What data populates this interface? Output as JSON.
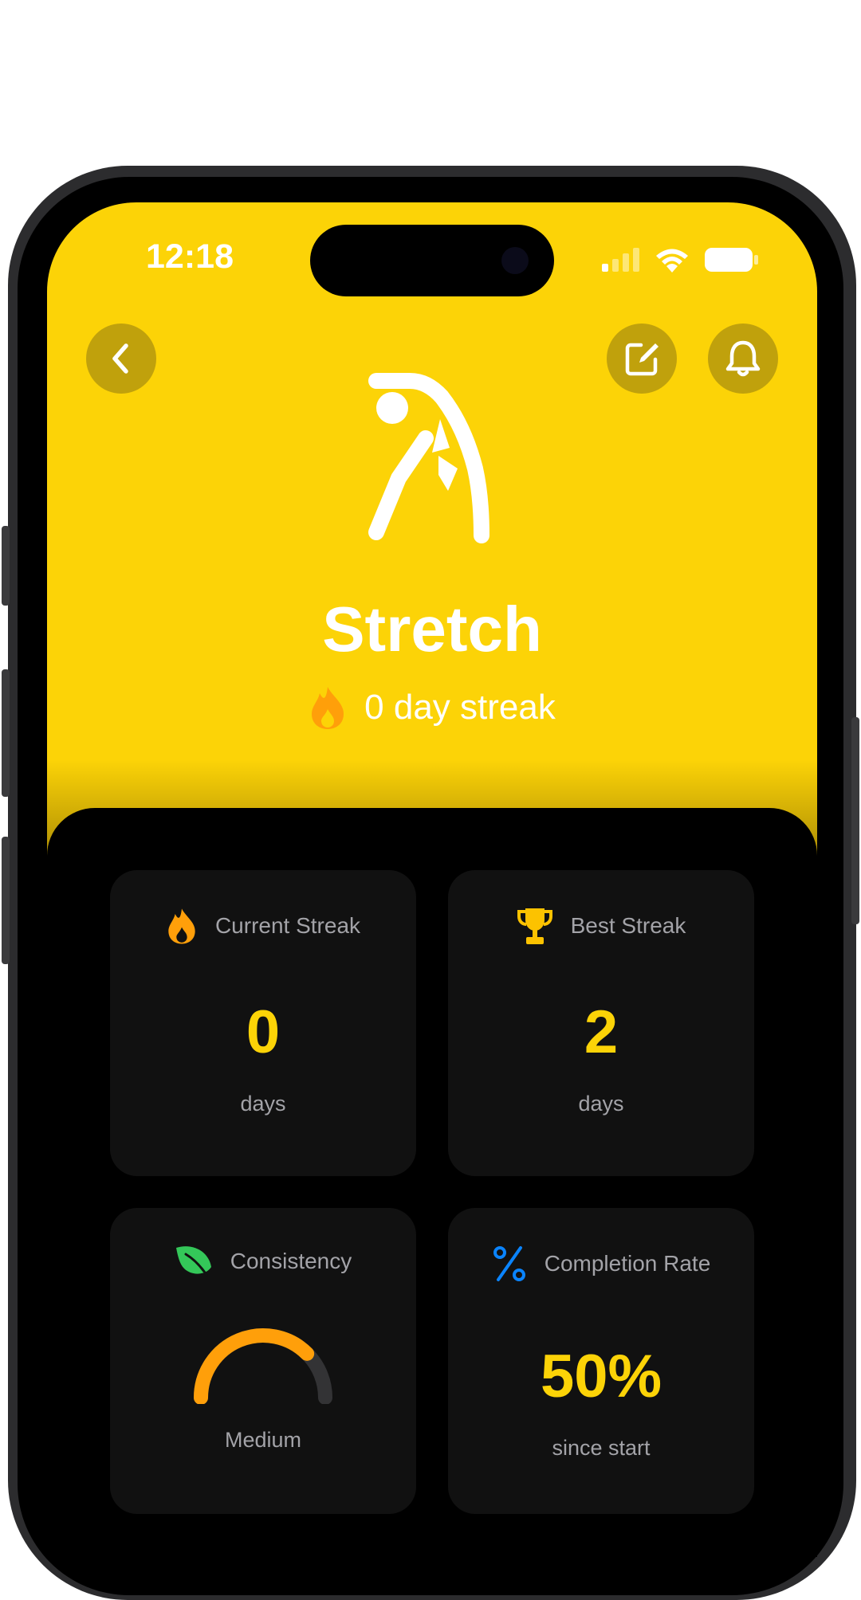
{
  "status_bar": {
    "time": "12:18"
  },
  "habit": {
    "title": "Stretch",
    "streak_text": "0 day streak"
  },
  "stats": {
    "current_streak": {
      "label": "Current Streak",
      "value": "0",
      "unit": "days"
    },
    "best_streak": {
      "label": "Best Streak",
      "value": "2",
      "unit": "days"
    },
    "consistency": {
      "label": "Consistency",
      "level_label": "Medium",
      "level_fraction": 0.75
    },
    "completion_rate": {
      "label": "Completion Rate",
      "value": "50%",
      "unit": "since start"
    }
  },
  "colors": {
    "accent": "#fcd307",
    "flame": "#ff9f0a",
    "trophy": "#fcc200",
    "leaf": "#34c759",
    "percent": "#0a84ff"
  }
}
